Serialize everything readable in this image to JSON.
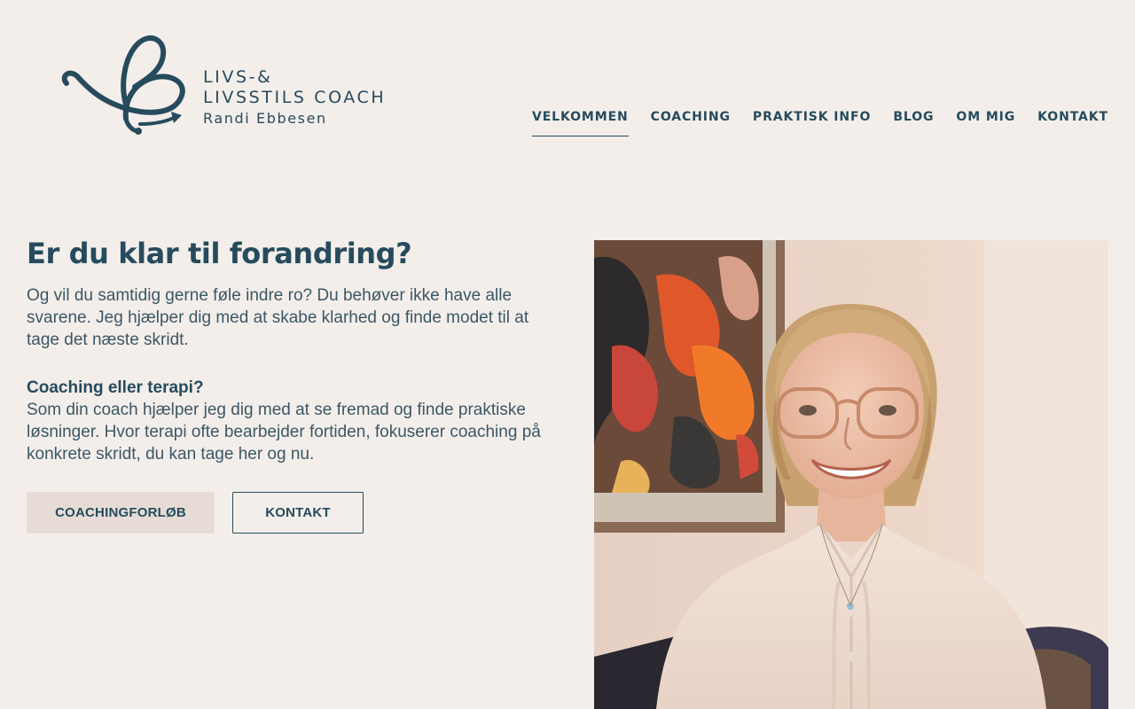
{
  "logo": {
    "line1": "LIVS-&",
    "line2": "LIVSSTILS COACH",
    "name": "Randi Ebbesen"
  },
  "nav": {
    "items": [
      "VELKOMMEN",
      "COACHING",
      "PRAKTISK INFO",
      "BLOG",
      "OM MIG",
      "KONTAKT"
    ],
    "active": "VELKOMMEN"
  },
  "hero": {
    "title": "Er du klar til forandring?",
    "intro": "Og vil du samtidig gerne føle indre ro? Du behøver ikke have alle svarene. Jeg hjælper dig med at skabe klarhed og finde modet til at tage det næste skridt.",
    "subheading": "Coaching eller terapi?",
    "body": "Som din coach hjælper jeg dig med at se fremad og finde praktiske løsninger. Hvor terapi ofte bearbejder fortiden, fokuserer coaching på konkrete skridt, du kan tage her og nu."
  },
  "buttons": {
    "primary": "COACHINGFORLØB",
    "secondary": "KONTAKT"
  },
  "colors": {
    "background": "#f3eeea",
    "text": "#264b5d",
    "button_primary_bg": "#e6dcd5"
  },
  "icons": {
    "logo_mark": "butterfly-arrow-icon"
  }
}
